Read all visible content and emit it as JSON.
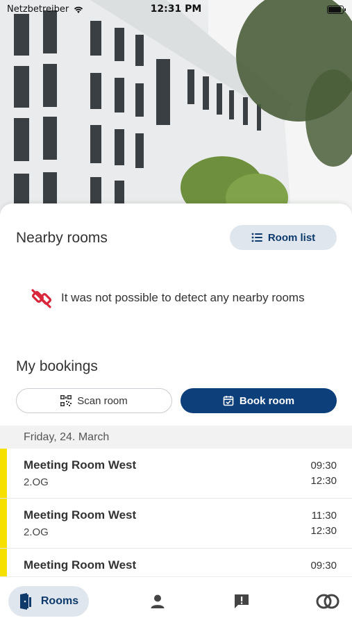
{
  "status_bar": {
    "carrier": "Netzbetreiber",
    "time": "12:31 PM",
    "icons": [
      "wifi-icon",
      "battery-icon"
    ]
  },
  "nearby": {
    "title": "Nearby rooms",
    "room_list_label": "Room list",
    "empty_message": "It was not possible to detect any nearby rooms"
  },
  "bookings": {
    "title": "My bookings",
    "scan_label": "Scan room",
    "book_label": "Book room",
    "date": "Friday,  24. March",
    "items": [
      {
        "name": "Meeting Room West",
        "floor": "2.OG",
        "start": "09:30",
        "end": "12:30"
      },
      {
        "name": "Meeting Room West",
        "floor": "2.OG",
        "start": "11:30",
        "end": "12:30"
      },
      {
        "name": "Meeting Room West",
        "floor": "",
        "start": "09:30",
        "end": ""
      }
    ]
  },
  "tabbar": {
    "rooms_label": "Rooms",
    "tabs": [
      "rooms-icon",
      "profile-icon",
      "feedback-icon",
      "app-logo-icon"
    ]
  },
  "colors": {
    "primary": "#0d3f7a",
    "accent_pill": "#dfe6ee",
    "booking_marker": "#f5e000",
    "warning_icon": "#d8263a"
  }
}
